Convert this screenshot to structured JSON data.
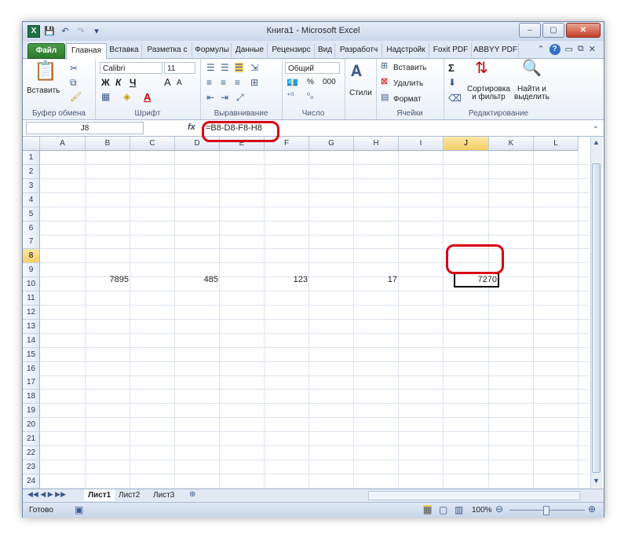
{
  "window": {
    "title": "Книга1  -  Microsoft Excel",
    "buttons": {
      "minimize": "–",
      "maximize": "▢",
      "close": "✕"
    }
  },
  "quick_access": {
    "app_icon": "X",
    "save_icon": "save-icon",
    "undo_icon": "undo-icon",
    "redo_icon": "redo-icon"
  },
  "tabs": [
    "Файл",
    "Главная",
    "Вставка",
    "Разметка с",
    "Формулы",
    "Данные",
    "Рецензирс",
    "Вид",
    "Разработч",
    "Надстройк",
    "Foxit PDF",
    "ABBYY PDF"
  ],
  "active_tab": "Главная",
  "ribbon": {
    "clipboard": {
      "paste": "Вставить",
      "label": "Буфер обмена"
    },
    "font": {
      "name": "Calibri",
      "size": "11",
      "bold": "Ж",
      "italic": "К",
      "underline": "Ч",
      "grow": "A",
      "shrink": "A",
      "color": "A",
      "label": "Шрифт"
    },
    "alignment": {
      "label": "Выравнивание"
    },
    "number": {
      "format": "Общий",
      "percent": "%",
      "thousands": "000",
      "label": "Число"
    },
    "styles": {
      "label": "Стили"
    },
    "cells": {
      "insert": "Вставить",
      "delete": "Удалить",
      "format": "Формат",
      "label": "Ячейки"
    },
    "editing": {
      "sum": "Σ",
      "sort": "Сортировка\nи фильтр",
      "find": "Найти и\nвыделить",
      "label": "Редактирование"
    }
  },
  "formula_bar": {
    "name_box": "J8",
    "fx": "fx",
    "formula": "=B8-D8-F8-H8"
  },
  "grid": {
    "columns": [
      "A",
      "B",
      "C",
      "D",
      "E",
      "F",
      "G",
      "H",
      "I",
      "J",
      "K",
      "L"
    ],
    "rows": [
      "1",
      "2",
      "3",
      "4",
      "5",
      "6",
      "7",
      "8",
      "9",
      "10",
      "11",
      "12",
      "13",
      "14",
      "15",
      "16",
      "17",
      "18",
      "19",
      "20",
      "21",
      "22",
      "23",
      "24"
    ],
    "selected_column": "J",
    "selected_row": "8",
    "cells": {
      "B8": "7895",
      "D8": "485",
      "F8": "123",
      "H8": "17",
      "J8": "7270"
    }
  },
  "sheets": [
    "Лист1",
    "Лист2",
    "Лист3"
  ],
  "active_sheet": "Лист1",
  "status": {
    "ready": "Готово",
    "zoom": "100%"
  },
  "colors": {
    "highlight": "#d70012",
    "selection": "#f6cf63",
    "file_tab": "#2b7a2b"
  }
}
